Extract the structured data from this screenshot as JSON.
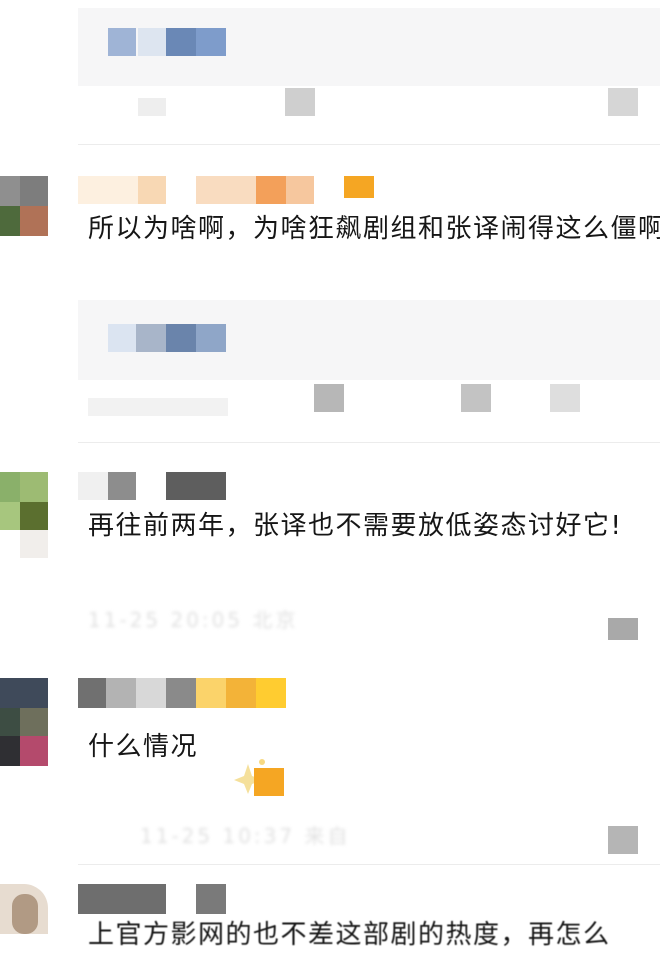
{
  "comments": [
    {
      "text": "所以为啥啊，为啥狂飙剧组和张译闹得这么僵啊"
    },
    {
      "text": "再往前两年，张译也不需要放低姿态讨好它!",
      "meta": "11-25 20:05 北京"
    },
    {
      "text": "什么情况",
      "meta": "11-25 10:37 来自"
    },
    {
      "text": "上官方影网的也不差这部剧的热度，再怎么"
    }
  ],
  "colors": {
    "reply_bg": "#f6f6f7",
    "divider": "#ececec",
    "mosaic_blue": "#6b8fbf",
    "mosaic_orange": "#f4a23c",
    "mosaic_green": "#7a9a52"
  }
}
